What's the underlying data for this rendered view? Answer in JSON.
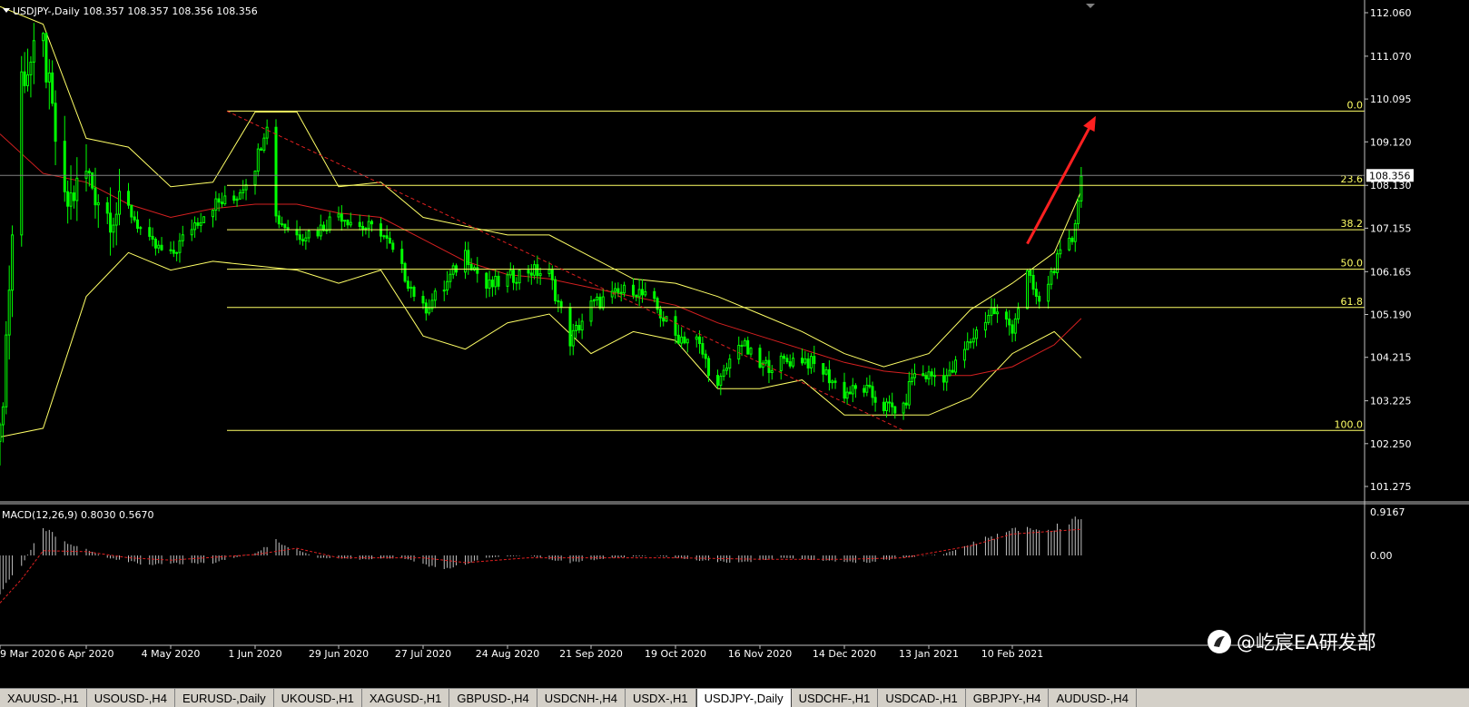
{
  "window": {
    "title": "USDJPY-,Daily  108.357 108.357 108.356 108.356",
    "symbol": "USDJPY-,Daily",
    "ohlc": "108.357 108.357 108.356 108.356"
  },
  "colors": {
    "background": "#000000",
    "candles": "#00ff00",
    "bands": "#ffff66",
    "ma": "#d42020",
    "fib": "#ffff66",
    "trend_dashed": "#e02020",
    "arrow": "#ff2020",
    "macd_hist": "#c0c0c0",
    "macd_signal": "#e02020",
    "axis_text": "#ffffff"
  },
  "chart_data": [
    {
      "type": "candlestick",
      "title": "USDJPY-,Daily",
      "ylim": [
        100.8,
        112.5
      ],
      "y_ticks": [
        "112.060",
        "111.070",
        "110.095",
        "109.120",
        "108.130",
        "107.155",
        "106.165",
        "105.190",
        "104.215",
        "103.225",
        "102.250",
        "101.275"
      ],
      "x_ticks": [
        "9 Mar 2020",
        "6 Apr 2020",
        "4 May 2020",
        "1 Jun 2020",
        "29 Jun 2020",
        "27 Jul 2020",
        "24 Aug 2020",
        "21 Sep 2020",
        "19 Oct 2020",
        "16 Nov 2020",
        "14 Dec 2020",
        "13 Jan 2021",
        "10 Feb 2021"
      ],
      "current_price": "108.356",
      "fibonacci": {
        "levels": [
          {
            "label": "0.0",
            "price": 109.82
          },
          {
            "label": "23.6",
            "price": 108.13
          },
          {
            "label": "38.2",
            "price": 107.12
          },
          {
            "label": "50.0",
            "price": 106.22
          },
          {
            "label": "61.8",
            "price": 105.35
          },
          {
            "label": "100.0",
            "price": 102.55
          }
        ]
      },
      "close_path": [
        {
          "x": "9 Mar 2020",
          "y": 102.3
        },
        {
          "x": "16 Mar 2020",
          "y": 110.6
        },
        {
          "x": "23 Mar 2020",
          "y": 111.3
        },
        {
          "x": "30 Mar 2020",
          "y": 107.6
        },
        {
          "x": "6 Apr 2020",
          "y": 108.4
        },
        {
          "x": "13 Apr 2020",
          "y": 107.5
        },
        {
          "x": "20 Apr 2020",
          "y": 107.6
        },
        {
          "x": "27 Apr 2020",
          "y": 106.8
        },
        {
          "x": "4 May 2020",
          "y": 106.5
        },
        {
          "x": "11 May 2020",
          "y": 107.2
        },
        {
          "x": "18 May 2020",
          "y": 107.7
        },
        {
          "x": "25 May 2020",
          "y": 107.8
        },
        {
          "x": "1 Jun 2020",
          "y": 108.6
        },
        {
          "x": "5 Jun 2020",
          "y": 109.6
        },
        {
          "x": "8 Jun 2020",
          "y": 107.4
        },
        {
          "x": "15 Jun 2020",
          "y": 107.0
        },
        {
          "x": "22 Jun 2020",
          "y": 107.1
        },
        {
          "x": "29 Jun 2020",
          "y": 107.5
        },
        {
          "x": "6 Jul 2020",
          "y": 107.2
        },
        {
          "x": "13 Jul 2020",
          "y": 107.1
        },
        {
          "x": "20 Jul 2020",
          "y": 106.2
        },
        {
          "x": "27 Jul 2020",
          "y": 105.3
        },
        {
          "x": "3 Aug 2020",
          "y": 105.8
        },
        {
          "x": "10 Aug 2020",
          "y": 106.6
        },
        {
          "x": "17 Aug 2020",
          "y": 105.8
        },
        {
          "x": "24 Aug 2020",
          "y": 106.0
        },
        {
          "x": "31 Aug 2020",
          "y": 106.2
        },
        {
          "x": "7 Sep 2020",
          "y": 106.1
        },
        {
          "x": "14 Sep 2020",
          "y": 104.6
        },
        {
          "x": "21 Sep 2020",
          "y": 105.4
        },
        {
          "x": "28 Sep 2020",
          "y": 105.6
        },
        {
          "x": "5 Oct 2020",
          "y": 105.8
        },
        {
          "x": "12 Oct 2020",
          "y": 105.4
        },
        {
          "x": "19 Oct 2020",
          "y": 104.7
        },
        {
          "x": "26 Oct 2020",
          "y": 104.6
        },
        {
          "x": "2 Nov 2020",
          "y": 103.5
        },
        {
          "x": "9 Nov 2020",
          "y": 104.6
        },
        {
          "x": "16 Nov 2020",
          "y": 104.0
        },
        {
          "x": "23 Nov 2020",
          "y": 104.1
        },
        {
          "x": "30 Nov 2020",
          "y": 104.2
        },
        {
          "x": "7 Dec 2020",
          "y": 103.9
        },
        {
          "x": "14 Dec 2020",
          "y": 103.4
        },
        {
          "x": "21 Dec 2020",
          "y": 103.5
        },
        {
          "x": "28 Dec 2020",
          "y": 103.1
        },
        {
          "x": "4 Jan 2021",
          "y": 103.0
        },
        {
          "x": "7 Jan 2021",
          "y": 103.8
        },
        {
          "x": "13 Jan 2021",
          "y": 103.8
        },
        {
          "x": "20 Jan 2021",
          "y": 103.8
        },
        {
          "x": "27 Jan 2021",
          "y": 104.6
        },
        {
          "x": "3 Feb 2021",
          "y": 105.3
        },
        {
          "x": "10 Feb 2021",
          "y": 104.9
        },
        {
          "x": "15 Feb 2021",
          "y": 106.1
        },
        {
          "x": "19 Feb 2021",
          "y": 105.4
        },
        {
          "x": "24 Feb 2021",
          "y": 106.3
        },
        {
          "x": "2 Mar 2021",
          "y": 106.9
        },
        {
          "x": "5 Mar 2021",
          "y": 108.3
        }
      ],
      "upper_band": [
        {
          "x": "9 Mar 2020",
          "y": 112.2
        },
        {
          "x": "23 Mar 2020",
          "y": 111.8
        },
        {
          "x": "6 Apr 2020",
          "y": 109.2
        },
        {
          "x": "20 Apr 2020",
          "y": 109.0
        },
        {
          "x": "4 May 2020",
          "y": 108.1
        },
        {
          "x": "18 May 2020",
          "y": 108.2
        },
        {
          "x": "1 Jun 2020",
          "y": 109.8
        },
        {
          "x": "15 Jun 2020",
          "y": 109.8
        },
        {
          "x": "29 Jun 2020",
          "y": 108.1
        },
        {
          "x": "13 Jul 2020",
          "y": 108.2
        },
        {
          "x": "27 Jul 2020",
          "y": 107.4
        },
        {
          "x": "10 Aug 2020",
          "y": 107.2
        },
        {
          "x": "24 Aug 2020",
          "y": 107.0
        },
        {
          "x": "7 Sep 2020",
          "y": 107.0
        },
        {
          "x": "21 Sep 2020",
          "y": 106.5
        },
        {
          "x": "5 Oct 2020",
          "y": 106.0
        },
        {
          "x": "19 Oct 2020",
          "y": 105.9
        },
        {
          "x": "2 Nov 2020",
          "y": 105.6
        },
        {
          "x": "16 Nov 2020",
          "y": 105.2
        },
        {
          "x": "30 Nov 2020",
          "y": 104.8
        },
        {
          "x": "14 Dec 2020",
          "y": 104.3
        },
        {
          "x": "28 Dec 2020",
          "y": 104.0
        },
        {
          "x": "13 Jan 2021",
          "y": 104.3
        },
        {
          "x": "27 Jan 2021",
          "y": 105.3
        },
        {
          "x": "10 Feb 2021",
          "y": 105.9
        },
        {
          "x": "24 Feb 2021",
          "y": 106.6
        },
        {
          "x": "5 Mar 2021",
          "y": 108.0
        }
      ],
      "lower_band": [
        {
          "x": "9 Mar 2020",
          "y": 102.4
        },
        {
          "x": "23 Mar 2020",
          "y": 102.6
        },
        {
          "x": "6 Apr 2020",
          "y": 105.6
        },
        {
          "x": "20 Apr 2020",
          "y": 106.6
        },
        {
          "x": "4 May 2020",
          "y": 106.2
        },
        {
          "x": "18 May 2020",
          "y": 106.4
        },
        {
          "x": "1 Jun 2020",
          "y": 106.3
        },
        {
          "x": "15 Jun 2020",
          "y": 106.2
        },
        {
          "x": "29 Jun 2020",
          "y": 105.9
        },
        {
          "x": "13 Jul 2020",
          "y": 106.2
        },
        {
          "x": "27 Jul 2020",
          "y": 104.7
        },
        {
          "x": "10 Aug 2020",
          "y": 104.4
        },
        {
          "x": "24 Aug 2020",
          "y": 105.0
        },
        {
          "x": "7 Sep 2020",
          "y": 105.2
        },
        {
          "x": "21 Sep 2020",
          "y": 104.3
        },
        {
          "x": "5 Oct 2020",
          "y": 104.8
        },
        {
          "x": "19 Oct 2020",
          "y": 104.6
        },
        {
          "x": "2 Nov 2020",
          "y": 103.5
        },
        {
          "x": "16 Nov 2020",
          "y": 103.5
        },
        {
          "x": "30 Nov 2020",
          "y": 103.7
        },
        {
          "x": "14 Dec 2020",
          "y": 102.9
        },
        {
          "x": "28 Dec 2020",
          "y": 102.9
        },
        {
          "x": "13 Jan 2021",
          "y": 102.9
        },
        {
          "x": "27 Jan 2021",
          "y": 103.3
        },
        {
          "x": "10 Feb 2021",
          "y": 104.3
        },
        {
          "x": "24 Feb 2021",
          "y": 104.8
        },
        {
          "x": "5 Mar 2021",
          "y": 104.2
        }
      ],
      "moving_average": [
        {
          "x": "9 Mar 2020",
          "y": 109.3
        },
        {
          "x": "23 Mar 2020",
          "y": 108.4
        },
        {
          "x": "6 Apr 2020",
          "y": 108.2
        },
        {
          "x": "20 Apr 2020",
          "y": 107.7
        },
        {
          "x": "4 May 2020",
          "y": 107.4
        },
        {
          "x": "18 May 2020",
          "y": 107.6
        },
        {
          "x": "1 Jun 2020",
          "y": 107.7
        },
        {
          "x": "15 Jun 2020",
          "y": 107.7
        },
        {
          "x": "29 Jun 2020",
          "y": 107.5
        },
        {
          "x": "13 Jul 2020",
          "y": 107.4
        },
        {
          "x": "27 Jul 2020",
          "y": 106.9
        },
        {
          "x": "10 Aug 2020",
          "y": 106.4
        },
        {
          "x": "24 Aug 2020",
          "y": 106.1
        },
        {
          "x": "7 Sep 2020",
          "y": 106.0
        },
        {
          "x": "21 Sep 2020",
          "y": 105.8
        },
        {
          "x": "5 Oct 2020",
          "y": 105.6
        },
        {
          "x": "19 Oct 2020",
          "y": 105.4
        },
        {
          "x": "2 Nov 2020",
          "y": 105.0
        },
        {
          "x": "16 Nov 2020",
          "y": 104.7
        },
        {
          "x": "30 Nov 2020",
          "y": 104.4
        },
        {
          "x": "14 Dec 2020",
          "y": 104.1
        },
        {
          "x": "28 Dec 2020",
          "y": 103.9
        },
        {
          "x": "13 Jan 2021",
          "y": 103.8
        },
        {
          "x": "27 Jan 2021",
          "y": 103.8
        },
        {
          "x": "10 Feb 2021",
          "y": 104.0
        },
        {
          "x": "24 Feb 2021",
          "y": 104.5
        },
        {
          "x": "5 Mar 2021",
          "y": 105.1
        }
      ]
    },
    {
      "type": "bar",
      "title": "MACD(12,26,9) 0.8030 0.5670",
      "ylim": [
        -1.1,
        1.0
      ],
      "y_ticks": [
        "0.9167",
        "0.00"
      ],
      "histogram_envelope": [
        {
          "x": "9 Mar 2020",
          "y": -0.8
        },
        {
          "x": "16 Mar 2020",
          "y": -0.2
        },
        {
          "x": "23 Mar 2020",
          "y": 0.55
        },
        {
          "x": "30 Mar 2020",
          "y": 0.3
        },
        {
          "x": "13 Apr 2020",
          "y": -0.05
        },
        {
          "x": "27 Apr 2020",
          "y": -0.2
        },
        {
          "x": "18 May 2020",
          "y": -0.15
        },
        {
          "x": "1 Jun 2020",
          "y": 0.05
        },
        {
          "x": "8 Jun 2020",
          "y": 0.3
        },
        {
          "x": "22 Jun 2020",
          "y": -0.05
        },
        {
          "x": "6 Jul 2020",
          "y": -0.08
        },
        {
          "x": "20 Jul 2020",
          "y": -0.05
        },
        {
          "x": "3 Aug 2020",
          "y": -0.3
        },
        {
          "x": "17 Aug 2020",
          "y": -0.05
        },
        {
          "x": "31 Aug 2020",
          "y": 0.0
        },
        {
          "x": "14 Sep 2020",
          "y": -0.15
        },
        {
          "x": "28 Sep 2020",
          "y": -0.05
        },
        {
          "x": "12 Oct 2020",
          "y": 0.0
        },
        {
          "x": "26 Oct 2020",
          "y": -0.1
        },
        {
          "x": "9 Nov 2020",
          "y": -0.15
        },
        {
          "x": "23 Nov 2020",
          "y": -0.05
        },
        {
          "x": "7 Dec 2020",
          "y": -0.1
        },
        {
          "x": "21 Dec 2020",
          "y": -0.15
        },
        {
          "x": "4 Jan 2021",
          "y": -0.05
        },
        {
          "x": "18 Jan 2021",
          "y": 0.03
        },
        {
          "x": "1 Feb 2021",
          "y": 0.35
        },
        {
          "x": "15 Feb 2021",
          "y": 0.6
        },
        {
          "x": "22 Feb 2021",
          "y": 0.5
        },
        {
          "x": "5 Mar 2021",
          "y": 0.85
        }
      ],
      "signal_line": [
        {
          "x": "9 Mar 2020",
          "y": -1.0
        },
        {
          "x": "16 Mar 2020",
          "y": -0.5
        },
        {
          "x": "23 Mar 2020",
          "y": 0.1
        },
        {
          "x": "6 Apr 2020",
          "y": 0.08
        },
        {
          "x": "20 Apr 2020",
          "y": -0.05
        },
        {
          "x": "4 May 2020",
          "y": -0.1
        },
        {
          "x": "1 Jun 2020",
          "y": 0.02
        },
        {
          "x": "15 Jun 2020",
          "y": 0.15
        },
        {
          "x": "29 Jun 2020",
          "y": -0.05
        },
        {
          "x": "27 Jul 2020",
          "y": -0.05
        },
        {
          "x": "10 Aug 2020",
          "y": -0.15
        },
        {
          "x": "31 Aug 2020",
          "y": -0.05
        },
        {
          "x": "21 Sep 2020",
          "y": -0.05
        },
        {
          "x": "19 Oct 2020",
          "y": -0.05
        },
        {
          "x": "16 Nov 2020",
          "y": -0.08
        },
        {
          "x": "14 Dec 2020",
          "y": -0.08
        },
        {
          "x": "4 Jan 2021",
          "y": -0.05
        },
        {
          "x": "27 Jan 2021",
          "y": 0.2
        },
        {
          "x": "10 Feb 2021",
          "y": 0.45
        },
        {
          "x": "5 Mar 2021",
          "y": 0.55
        }
      ]
    }
  ],
  "tabs": [
    {
      "label": "XAUUSD-,H1",
      "active": false
    },
    {
      "label": "USOUSD-,H4",
      "active": false
    },
    {
      "label": "EURUSD-,Daily",
      "active": false
    },
    {
      "label": "UKOUSD-,H1",
      "active": false
    },
    {
      "label": "XAGUSD-,H1",
      "active": false
    },
    {
      "label": "GBPUSD-,H4",
      "active": false
    },
    {
      "label": "USDCNH-,H4",
      "active": false
    },
    {
      "label": "USDX-,H1",
      "active": false
    },
    {
      "label": "USDJPY-,Daily",
      "active": true
    },
    {
      "label": "USDCHF-,H1",
      "active": false
    },
    {
      "label": "USDCAD-,H1",
      "active": false
    },
    {
      "label": "GBPJPY-,H4",
      "active": false
    },
    {
      "label": "AUDUSD-,H4",
      "active": false
    }
  ],
  "watermark": "@屹宸EA研发部"
}
